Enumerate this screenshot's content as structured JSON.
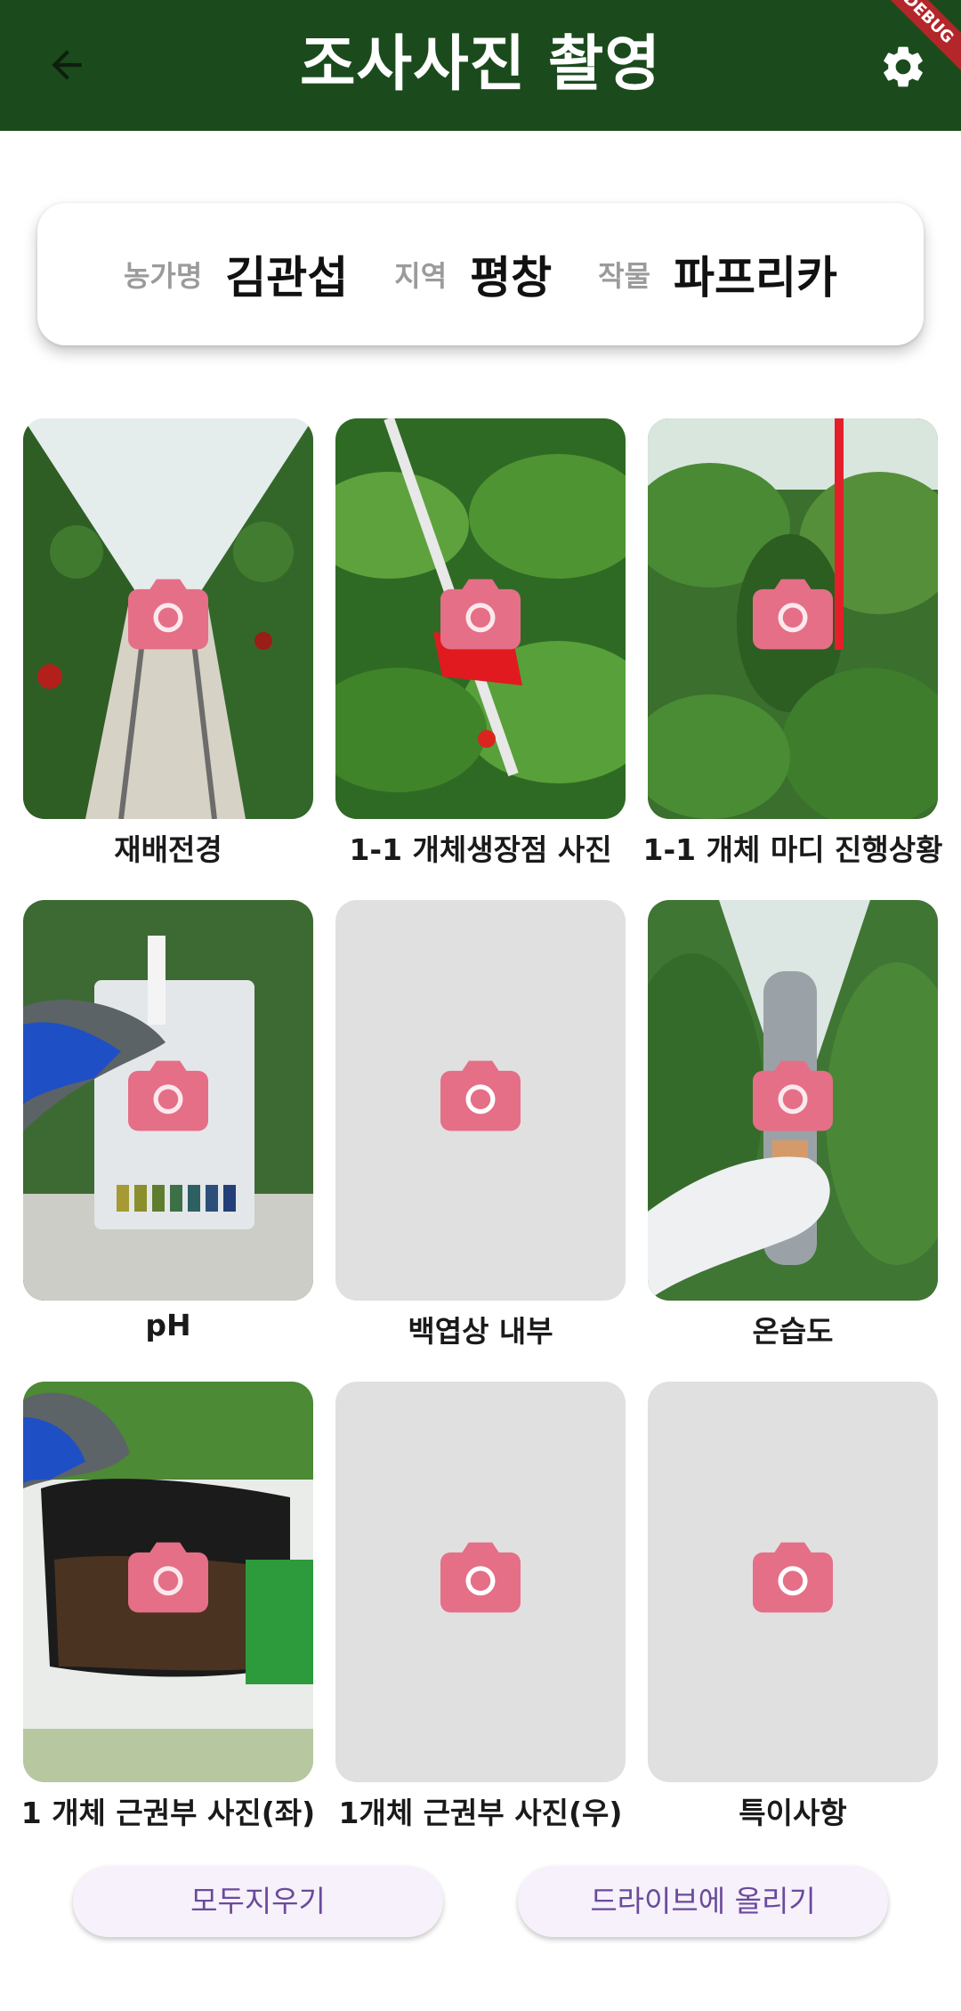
{
  "app_bar": {
    "title": "조사사진 촬영",
    "back_icon": "arrow-left-icon",
    "settings_icon": "gear-icon",
    "banner_text": "DEBUG",
    "color": "#1b4b1c"
  },
  "info": {
    "farmer_label": "농가명",
    "farmer_value": "김관섭",
    "region_label": "지역",
    "region_value": "평창",
    "crop_label": "작물",
    "crop_value": "파프리카"
  },
  "photos": [
    {
      "caption": "재배전경",
      "has_photo": true
    },
    {
      "caption": "1-1 개체생장점 사진",
      "has_photo": true
    },
    {
      "caption": "1-1 개체 마디 진행상황",
      "has_photo": true
    },
    {
      "caption": "pH",
      "has_photo": true
    },
    {
      "caption": "백엽상 내부",
      "has_photo": false
    },
    {
      "caption": "온습도",
      "has_photo": true
    },
    {
      "caption": "1 개체 근권부 사진(좌)",
      "has_photo": true
    },
    {
      "caption": "1개체 근권부 사진(우)",
      "has_photo": false
    },
    {
      "caption": "특이사항",
      "has_photo": false
    }
  ],
  "camera_icon": "camera-icon",
  "camera_color": "#e56f87",
  "actions": {
    "clear_label": "모두지우기",
    "upload_label": "드라이브에 올리기",
    "text_color": "#6a4a9c"
  }
}
